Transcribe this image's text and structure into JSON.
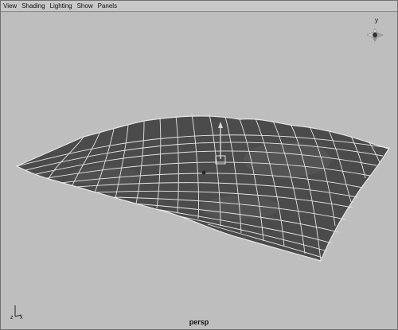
{
  "menubar": {
    "items": [
      "View",
      "Shading",
      "Lighting",
      "Show",
      "Panels"
    ]
  },
  "viewport": {
    "camera_label": "persp",
    "view_cube_axis": "y",
    "origin_axis_z": "z",
    "origin_axis_x": "x"
  },
  "colors": {
    "background": "#bebebe",
    "mesh_fill": "#4a4a4a",
    "wireframe": "#e8e8e8"
  },
  "icons": [
    "view-cube-icon",
    "origin-axis-icon",
    "move-manipulator-icon"
  ]
}
